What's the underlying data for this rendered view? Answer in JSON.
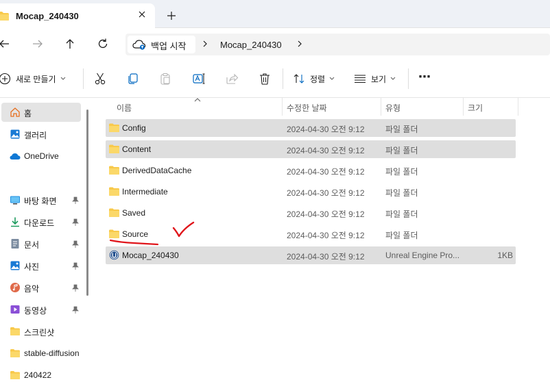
{
  "tab": {
    "title": "Mocap_240430",
    "close_icon": "close-icon",
    "new_tab_icon": "plus-icon"
  },
  "address": {
    "backup_label": "백업 시작",
    "path": [
      "Mocap_240430"
    ]
  },
  "toolbar": {
    "new_label": "새로 만들기",
    "sort_label": "정렬",
    "view_label": "보기",
    "more_label": "⋯"
  },
  "sidebar": {
    "items": [
      {
        "label": "홈",
        "icon": "home-icon",
        "pinned": false
      },
      {
        "label": "갤러리",
        "icon": "gallery-icon",
        "pinned": false
      },
      {
        "label": "OneDrive",
        "icon": "cloud-icon",
        "pinned": false
      },
      {
        "label": "바탕 화면",
        "icon": "desktop-icon",
        "pinned": true
      },
      {
        "label": "다운로드",
        "icon": "download-icon",
        "pinned": true
      },
      {
        "label": "문서",
        "icon": "document-icon",
        "pinned": true
      },
      {
        "label": "사진",
        "icon": "pictures-icon",
        "pinned": true
      },
      {
        "label": "음악",
        "icon": "music-icon",
        "pinned": true
      },
      {
        "label": "동영상",
        "icon": "video-icon",
        "pinned": true
      },
      {
        "label": "스크린샷",
        "icon": "folder-icon",
        "pinned": false
      },
      {
        "label": "stable-diffusion",
        "icon": "folder-icon",
        "pinned": false
      },
      {
        "label": "240422",
        "icon": "folder-icon",
        "pinned": false
      }
    ]
  },
  "columns": {
    "name": "이름",
    "modified": "수정한 날짜",
    "type": "유형",
    "size": "크기"
  },
  "files": [
    {
      "name": "Config",
      "modified": "2024-04-30 오전 9:12",
      "type": "파일 폴더",
      "size": "",
      "icon": "folder-icon",
      "selected": true
    },
    {
      "name": "Content",
      "modified": "2024-04-30 오전 9:12",
      "type": "파일 폴더",
      "size": "",
      "icon": "folder-icon",
      "selected": true
    },
    {
      "name": "DerivedDataCache",
      "modified": "2024-04-30 오전 9:12",
      "type": "파일 폴더",
      "size": "",
      "icon": "folder-icon",
      "selected": false
    },
    {
      "name": "Intermediate",
      "modified": "2024-04-30 오전 9:12",
      "type": "파일 폴더",
      "size": "",
      "icon": "folder-icon",
      "selected": false
    },
    {
      "name": "Saved",
      "modified": "2024-04-30 오전 9:12",
      "type": "파일 폴더",
      "size": "",
      "icon": "folder-icon",
      "selected": false
    },
    {
      "name": "Source",
      "modified": "2024-04-30 오전 9:12",
      "type": "파일 폴더",
      "size": "",
      "icon": "folder-icon",
      "selected": false
    },
    {
      "name": "Mocap_240430",
      "modified": "2024-04-30 오전 9:12",
      "type": "Unreal Engine Pro...",
      "size": "1KB",
      "icon": "unreal-project-icon",
      "selected": true
    }
  ],
  "colors": {
    "accent": "#0067c0",
    "folder": "#f8c94a",
    "selection": "#dedede",
    "annotation": "#e0151b"
  }
}
